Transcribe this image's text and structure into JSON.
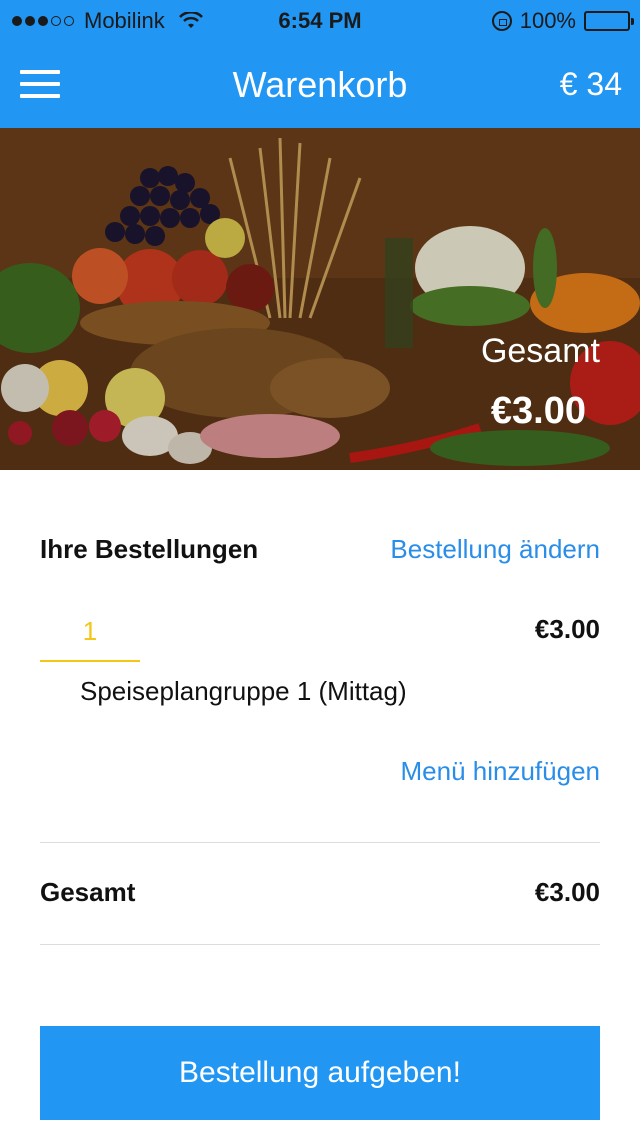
{
  "status_bar": {
    "carrier": "Mobilink",
    "time": "6:54 PM",
    "battery": "100%",
    "signal_bars_filled": 3,
    "signal_bars_total": 5
  },
  "nav": {
    "title": "Warenkorb",
    "balance": "€ 34",
    "menu_icon": "hamburger-icon"
  },
  "hero": {
    "total_label": "Gesamt",
    "total_amount": "€3.00"
  },
  "orders": {
    "title": "Ihre Bestellungen",
    "edit_link": "Bestellung ändern",
    "items": [
      {
        "quantity": "1",
        "price": "€3.00",
        "name": "Speiseplangruppe 1 (Mittag)"
      }
    ],
    "add_menu_link": "Menü hinzufügen"
  },
  "summary": {
    "total_label": "Gesamt",
    "total_amount": "€3.00"
  },
  "actions": {
    "submit_label": "Bestellung aufgeben!"
  },
  "colors": {
    "primary": "#2196f3",
    "link": "#2a8ee8",
    "accent": "#f5c518"
  }
}
